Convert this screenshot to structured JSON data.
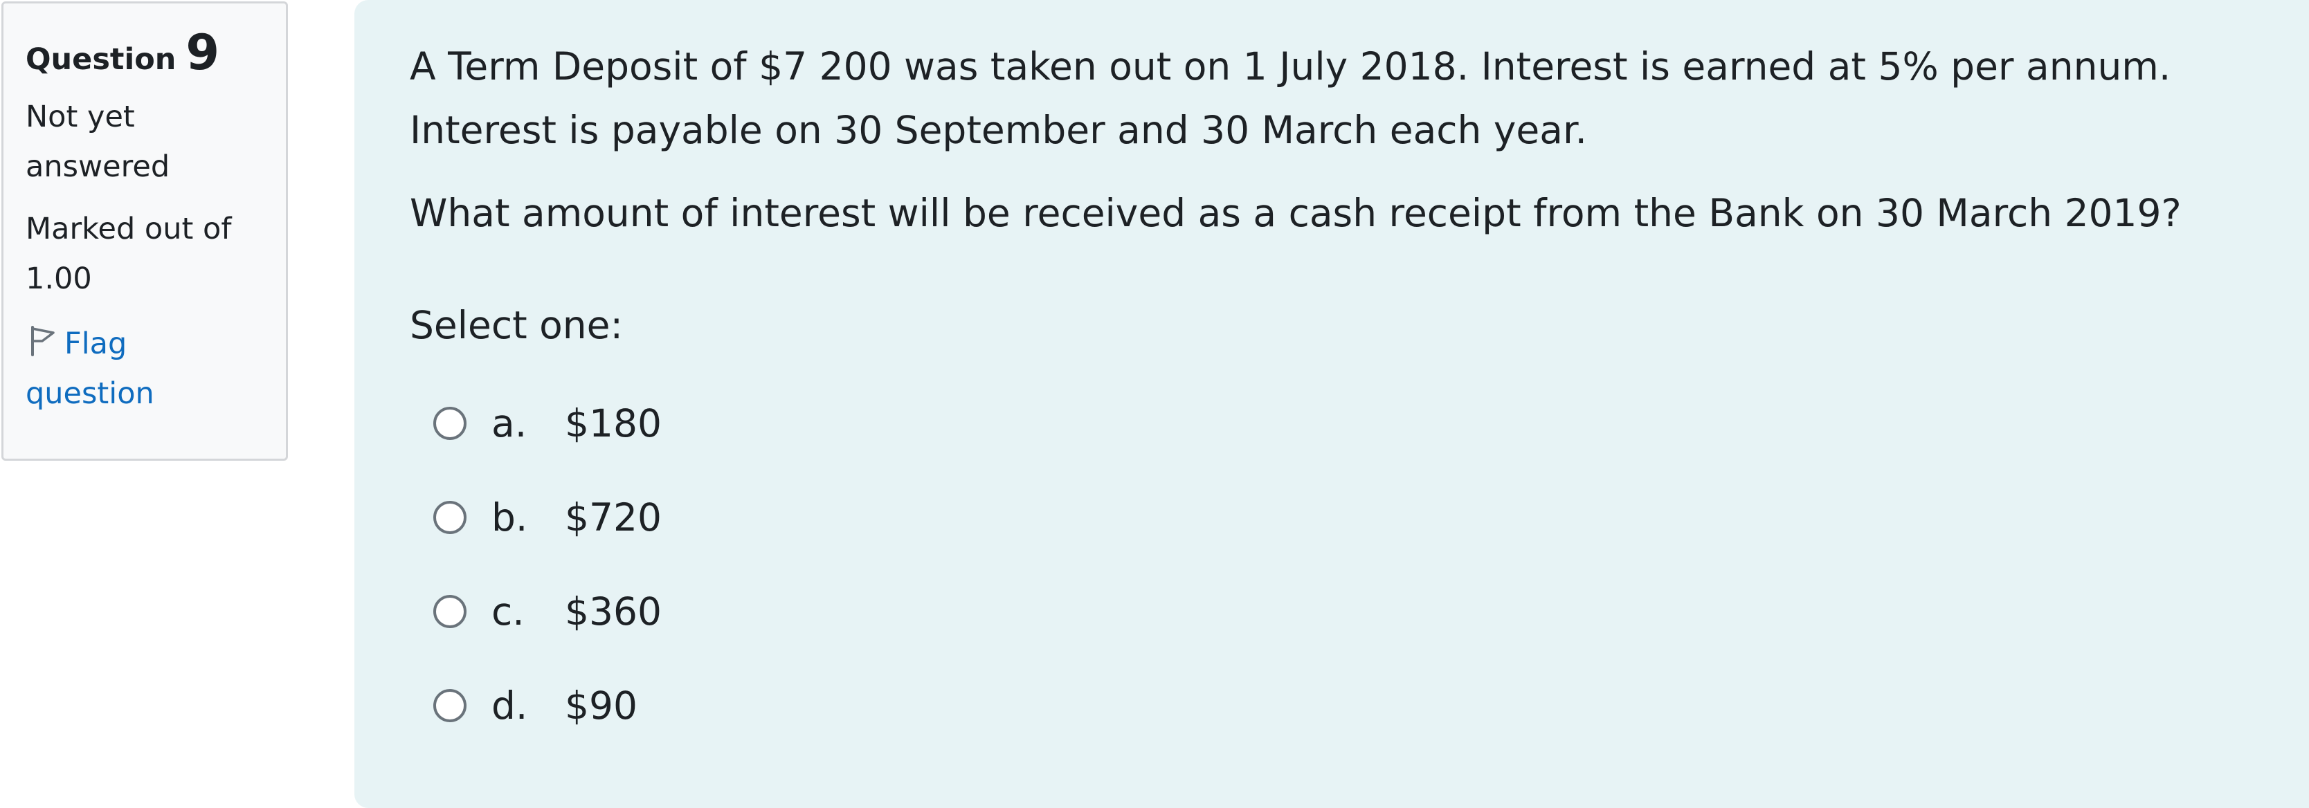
{
  "info": {
    "question_label": "Question",
    "question_number": "9",
    "state": "Not yet answered",
    "grade": "Marked out of 1.00",
    "flag_label": "Flag question",
    "flag_icon": "flag-outline-icon",
    "link_color": "#0f6cbf"
  },
  "question": {
    "paragraphs": [
      "A Term Deposit of $7 200 was taken out on 1 July 2018. Interest is earned at 5% per annum.",
      "Interest is payable on 30 September and 30 March each year.",
      "What amount of interest will be received as a cash receipt from the Bank on 30 March 2019?"
    ],
    "prompt": "Select one:",
    "answers": [
      {
        "number": "a.",
        "text": "$180"
      },
      {
        "number": "b.",
        "text": "$720"
      },
      {
        "number": "c.",
        "text": "$360"
      },
      {
        "number": "d.",
        "text": "$90"
      }
    ]
  },
  "colors": {
    "panel_background": "#e7f3f5",
    "info_background": "#f8f9fa"
  }
}
